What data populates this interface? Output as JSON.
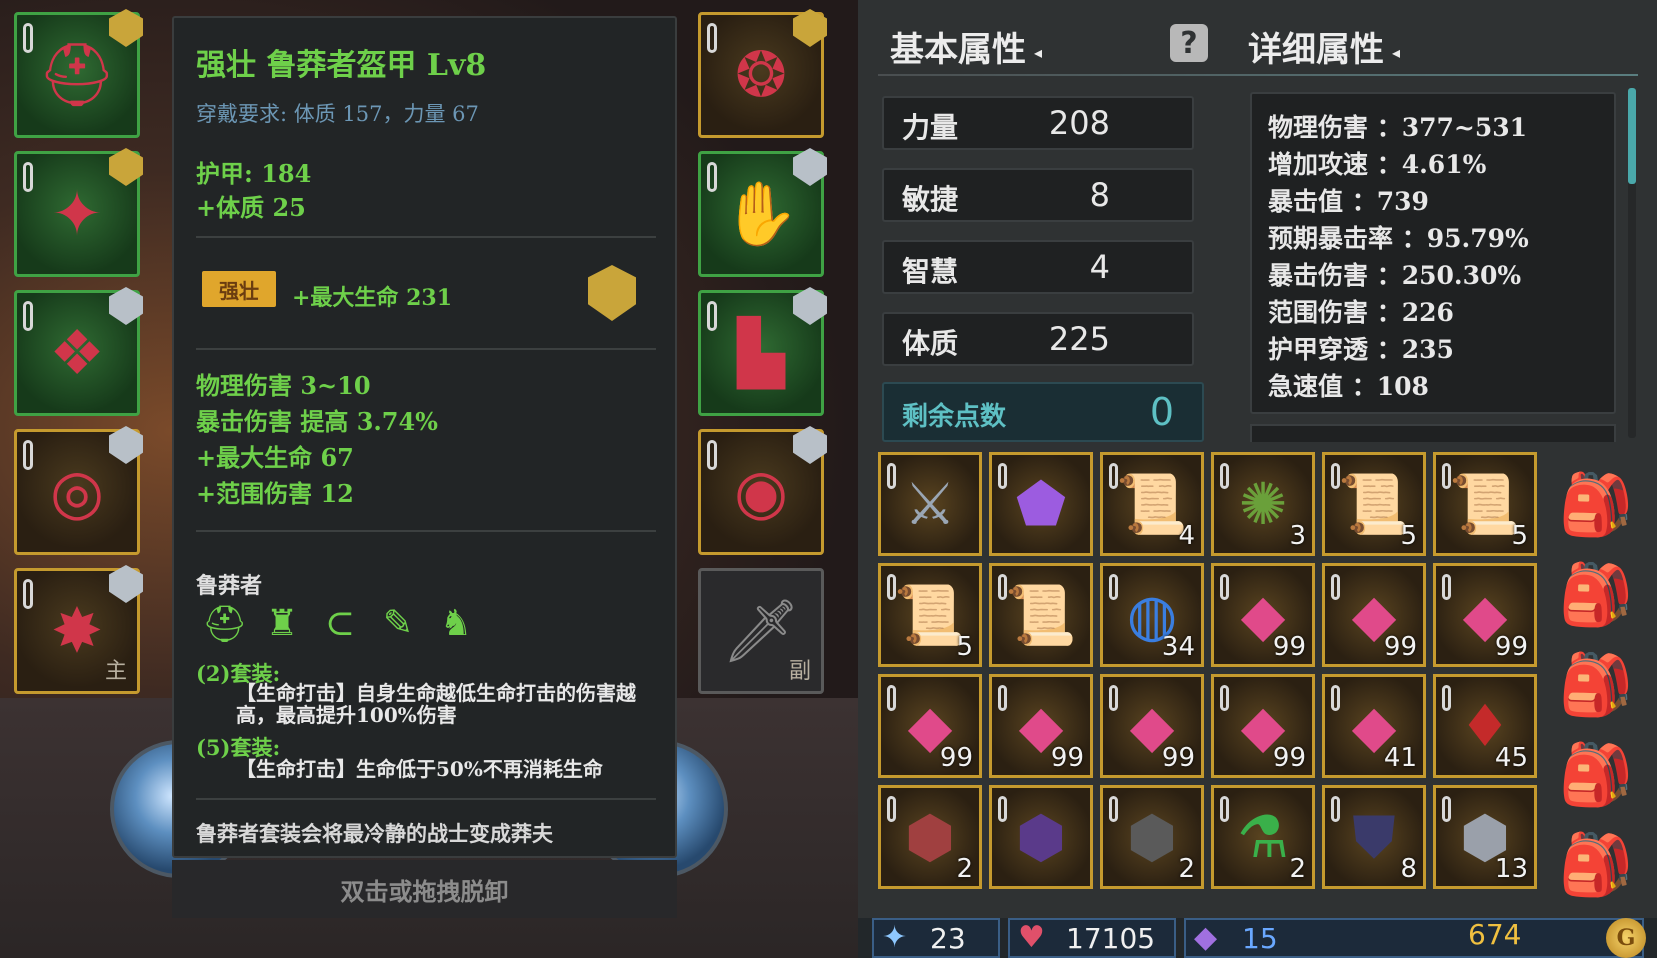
{
  "equipment_left": [
    {
      "name": "helmet",
      "icon": "helmet-icon",
      "glyph": "⛑",
      "frame": "green",
      "rank": "gold"
    },
    {
      "name": "chest",
      "icon": "armor-icon",
      "glyph": "✦",
      "frame": "green",
      "rank": "gold"
    },
    {
      "name": "belt",
      "icon": "belt-icon",
      "glyph": "❖",
      "frame": "green",
      "rank": "silver"
    },
    {
      "name": "ring",
      "icon": "ring-icon",
      "glyph": "◎",
      "frame": "gold",
      "rank": "silver"
    },
    {
      "name": "weapon",
      "icon": "spiked-mace-icon",
      "glyph": "✸",
      "frame": "gold",
      "rank": "silver",
      "mark": "主"
    }
  ],
  "equipment_right": [
    {
      "name": "amulet",
      "icon": "amulet-icon",
      "glyph": "❂",
      "frame": "gold",
      "rank": "gold"
    },
    {
      "name": "gloves",
      "icon": "gauntlet-icon",
      "glyph": "✋",
      "frame": "green",
      "rank": "silver"
    },
    {
      "name": "boots",
      "icon": "boots-icon",
      "glyph": "▙",
      "frame": "green",
      "rank": "silver"
    },
    {
      "name": "ring2",
      "icon": "ruby-ring-icon",
      "glyph": "◉",
      "frame": "gold",
      "rank": "silver"
    },
    {
      "name": "offhand",
      "icon": "sword-icon",
      "glyph": "🗡",
      "frame": "empty",
      "rank": "",
      "mark": "副"
    }
  ],
  "tooltip": {
    "title": "强壮 鲁莽者盔甲 Lv8",
    "requirement": "穿戴要求:  体质 157，力量 67",
    "armor": "护甲:  184",
    "bonus_constitution": "+体质 25",
    "affix_badge": "强壮",
    "affix_text": "+最大生命 231",
    "stats": [
      "物理伤害 3~10",
      "暴击伤害 提高 3.74%",
      "+最大生命 67",
      "+范围伤害 12"
    ],
    "set_name": "鲁莽者",
    "set_pieces": [
      "helmet-icon",
      "chest-icon",
      "belt-icon",
      "gauntlet-icon",
      "boots-icon"
    ],
    "set_piece_glyphs": [
      "⛑",
      "♜",
      "⊂",
      "✎",
      "♞"
    ],
    "set_bonus_2_head": "(2)套装:",
    "set_bonus_2_body": "【生命打击】自身生命越低生命打击的伤害越高，最高提升100%伤害",
    "set_bonus_5_head": "(5)套装:",
    "set_bonus_5_body": "【生命打击】生命低于50%不再消耗生命",
    "flavor": "鲁莽者套装会将最冷静的战士变成莽夫",
    "unequip_hint": "双击或拖拽脱卸"
  },
  "basic_attrs": {
    "header": "基本属性",
    "help": "?",
    "rows": [
      {
        "label": "力量",
        "value": "208"
      },
      {
        "label": "敏捷",
        "value": "8"
      },
      {
        "label": "智慧",
        "value": "4"
      },
      {
        "label": "体质",
        "value": "225"
      }
    ],
    "remaining_label": "剩余点数",
    "remaining_value": "0"
  },
  "detail_attrs": {
    "header": "详细属性",
    "lines": [
      "物理伤害 ：377~531",
      "增加攻速 ：4.61%",
      "暴击值 ：739",
      "预期暴击率 ：95.79%",
      "暴击伤害 ：250.30%",
      "范围伤害 ：226",
      "护甲穿透 ：235",
      "急速值 ：108"
    ]
  },
  "inventory": [
    {
      "icon": "claw-ring-icon",
      "glyph": "⚔",
      "color": "#9aa6b4",
      "count": ""
    },
    {
      "icon": "amethyst-gem-icon",
      "glyph": "⬟",
      "color": "#9c5ce0",
      "count": ""
    },
    {
      "icon": "red-scroll-icon",
      "glyph": "📜",
      "color": "#c46a3a",
      "count": "4"
    },
    {
      "icon": "green-rune-icon",
      "glyph": "✺",
      "color": "#6aa03a",
      "count": "3"
    },
    {
      "icon": "gold-scroll-icon",
      "glyph": "📜",
      "color": "#d8b040",
      "count": "5"
    },
    {
      "icon": "gold-scroll-icon",
      "glyph": "📜",
      "color": "#d8b040",
      "count": "5"
    },
    {
      "icon": "gold-scroll-icon",
      "glyph": "📜",
      "color": "#d8b040",
      "count": "5"
    },
    {
      "icon": "gold-scroll-icon",
      "glyph": "📜",
      "color": "#d8b040",
      "count": ""
    },
    {
      "icon": "blue-orb-icon",
      "glyph": "◍",
      "color": "#3a7ee0",
      "count": "34"
    },
    {
      "icon": "pink-gem-icon",
      "glyph": "◆",
      "color": "#e04a8a",
      "count": "99"
    },
    {
      "icon": "pink-gem-icon",
      "glyph": "◆",
      "color": "#e04a8a",
      "count": "99"
    },
    {
      "icon": "pink-gem-icon",
      "glyph": "◆",
      "color": "#e04a8a",
      "count": "99"
    },
    {
      "icon": "pink-gem-icon",
      "glyph": "◆",
      "color": "#e04a8a",
      "count": "99"
    },
    {
      "icon": "pink-gem-icon",
      "glyph": "◆",
      "color": "#e04a8a",
      "count": "99"
    },
    {
      "icon": "pink-gem-icon",
      "glyph": "◆",
      "color": "#e04a8a",
      "count": "99"
    },
    {
      "icon": "pink-gem-icon",
      "glyph": "◆",
      "color": "#e04a8a",
      "count": "99"
    },
    {
      "icon": "pink-gem-icon",
      "glyph": "◆",
      "color": "#e04a8a",
      "count": "41"
    },
    {
      "icon": "red-crystal-icon",
      "glyph": "♦",
      "color": "#c42a2a",
      "count": "45"
    },
    {
      "icon": "ruby-ore-icon",
      "glyph": "⬢",
      "color": "#a04040",
      "count": "2"
    },
    {
      "icon": "dark-crystal-icon",
      "glyph": "⬢",
      "color": "#5a3a8a",
      "count": ""
    },
    {
      "icon": "coal-ore-icon",
      "glyph": "⬢",
      "color": "#5a5a5a",
      "count": "2"
    },
    {
      "icon": "green-potion-icon",
      "glyph": "⚗",
      "color": "#3ab04a",
      "count": "2"
    },
    {
      "icon": "dark-armor-plate-icon",
      "glyph": "⛊",
      "color": "#3a3a6a",
      "count": "8"
    },
    {
      "icon": "iron-ore-icon",
      "glyph": "⬢",
      "color": "#9aa0aa",
      "count": "13"
    }
  ],
  "bags": [
    {
      "icon": "backpack-icon",
      "glyph": "🎒"
    },
    {
      "icon": "backpack-icon",
      "glyph": "🎒"
    },
    {
      "icon": "backpack-icon",
      "glyph": "🎒"
    },
    {
      "icon": "backpack-icon",
      "glyph": "🎒"
    },
    {
      "icon": "backpack-icon",
      "glyph": "🎒"
    }
  ],
  "currency": {
    "wands": "23",
    "hearts": "17105",
    "crystals": "15",
    "gold": "674"
  },
  "colors": {
    "set_green": "#6ed04a",
    "requirement_blue": "#6c97b5",
    "accent_teal": "#5ec0c4",
    "frame_gold": "#c59a2e",
    "frame_green": "#3fa244"
  }
}
